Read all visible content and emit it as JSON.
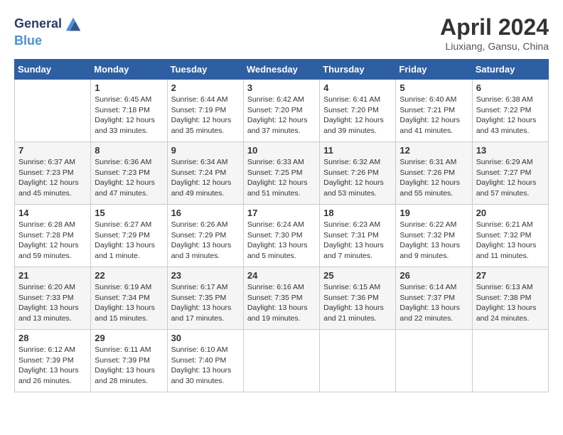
{
  "header": {
    "logo_line1": "General",
    "logo_line2": "Blue",
    "month": "April 2024",
    "location": "Liuxiang, Gansu, China"
  },
  "days_of_week": [
    "Sunday",
    "Monday",
    "Tuesday",
    "Wednesday",
    "Thursday",
    "Friday",
    "Saturday"
  ],
  "weeks": [
    [
      {
        "day": "",
        "sunrise": "",
        "sunset": "",
        "daylight": ""
      },
      {
        "day": "1",
        "sunrise": "Sunrise: 6:45 AM",
        "sunset": "Sunset: 7:18 PM",
        "daylight": "Daylight: 12 hours and 33 minutes."
      },
      {
        "day": "2",
        "sunrise": "Sunrise: 6:44 AM",
        "sunset": "Sunset: 7:19 PM",
        "daylight": "Daylight: 12 hours and 35 minutes."
      },
      {
        "day": "3",
        "sunrise": "Sunrise: 6:42 AM",
        "sunset": "Sunset: 7:20 PM",
        "daylight": "Daylight: 12 hours and 37 minutes."
      },
      {
        "day": "4",
        "sunrise": "Sunrise: 6:41 AM",
        "sunset": "Sunset: 7:20 PM",
        "daylight": "Daylight: 12 hours and 39 minutes."
      },
      {
        "day": "5",
        "sunrise": "Sunrise: 6:40 AM",
        "sunset": "Sunset: 7:21 PM",
        "daylight": "Daylight: 12 hours and 41 minutes."
      },
      {
        "day": "6",
        "sunrise": "Sunrise: 6:38 AM",
        "sunset": "Sunset: 7:22 PM",
        "daylight": "Daylight: 12 hours and 43 minutes."
      }
    ],
    [
      {
        "day": "7",
        "sunrise": "Sunrise: 6:37 AM",
        "sunset": "Sunset: 7:23 PM",
        "daylight": "Daylight: 12 hours and 45 minutes."
      },
      {
        "day": "8",
        "sunrise": "Sunrise: 6:36 AM",
        "sunset": "Sunset: 7:23 PM",
        "daylight": "Daylight: 12 hours and 47 minutes."
      },
      {
        "day": "9",
        "sunrise": "Sunrise: 6:34 AM",
        "sunset": "Sunset: 7:24 PM",
        "daylight": "Daylight: 12 hours and 49 minutes."
      },
      {
        "day": "10",
        "sunrise": "Sunrise: 6:33 AM",
        "sunset": "Sunset: 7:25 PM",
        "daylight": "Daylight: 12 hours and 51 minutes."
      },
      {
        "day": "11",
        "sunrise": "Sunrise: 6:32 AM",
        "sunset": "Sunset: 7:26 PM",
        "daylight": "Daylight: 12 hours and 53 minutes."
      },
      {
        "day": "12",
        "sunrise": "Sunrise: 6:31 AM",
        "sunset": "Sunset: 7:26 PM",
        "daylight": "Daylight: 12 hours and 55 minutes."
      },
      {
        "day": "13",
        "sunrise": "Sunrise: 6:29 AM",
        "sunset": "Sunset: 7:27 PM",
        "daylight": "Daylight: 12 hours and 57 minutes."
      }
    ],
    [
      {
        "day": "14",
        "sunrise": "Sunrise: 6:28 AM",
        "sunset": "Sunset: 7:28 PM",
        "daylight": "Daylight: 12 hours and 59 minutes."
      },
      {
        "day": "15",
        "sunrise": "Sunrise: 6:27 AM",
        "sunset": "Sunset: 7:29 PM",
        "daylight": "Daylight: 13 hours and 1 minute."
      },
      {
        "day": "16",
        "sunrise": "Sunrise: 6:26 AM",
        "sunset": "Sunset: 7:29 PM",
        "daylight": "Daylight: 13 hours and 3 minutes."
      },
      {
        "day": "17",
        "sunrise": "Sunrise: 6:24 AM",
        "sunset": "Sunset: 7:30 PM",
        "daylight": "Daylight: 13 hours and 5 minutes."
      },
      {
        "day": "18",
        "sunrise": "Sunrise: 6:23 AM",
        "sunset": "Sunset: 7:31 PM",
        "daylight": "Daylight: 13 hours and 7 minutes."
      },
      {
        "day": "19",
        "sunrise": "Sunrise: 6:22 AM",
        "sunset": "Sunset: 7:32 PM",
        "daylight": "Daylight: 13 hours and 9 minutes."
      },
      {
        "day": "20",
        "sunrise": "Sunrise: 6:21 AM",
        "sunset": "Sunset: 7:32 PM",
        "daylight": "Daylight: 13 hours and 11 minutes."
      }
    ],
    [
      {
        "day": "21",
        "sunrise": "Sunrise: 6:20 AM",
        "sunset": "Sunset: 7:33 PM",
        "daylight": "Daylight: 13 hours and 13 minutes."
      },
      {
        "day": "22",
        "sunrise": "Sunrise: 6:19 AM",
        "sunset": "Sunset: 7:34 PM",
        "daylight": "Daylight: 13 hours and 15 minutes."
      },
      {
        "day": "23",
        "sunrise": "Sunrise: 6:17 AM",
        "sunset": "Sunset: 7:35 PM",
        "daylight": "Daylight: 13 hours and 17 minutes."
      },
      {
        "day": "24",
        "sunrise": "Sunrise: 6:16 AM",
        "sunset": "Sunset: 7:35 PM",
        "daylight": "Daylight: 13 hours and 19 minutes."
      },
      {
        "day": "25",
        "sunrise": "Sunrise: 6:15 AM",
        "sunset": "Sunset: 7:36 PM",
        "daylight": "Daylight: 13 hours and 21 minutes."
      },
      {
        "day": "26",
        "sunrise": "Sunrise: 6:14 AM",
        "sunset": "Sunset: 7:37 PM",
        "daylight": "Daylight: 13 hours and 22 minutes."
      },
      {
        "day": "27",
        "sunrise": "Sunrise: 6:13 AM",
        "sunset": "Sunset: 7:38 PM",
        "daylight": "Daylight: 13 hours and 24 minutes."
      }
    ],
    [
      {
        "day": "28",
        "sunrise": "Sunrise: 6:12 AM",
        "sunset": "Sunset: 7:39 PM",
        "daylight": "Daylight: 13 hours and 26 minutes."
      },
      {
        "day": "29",
        "sunrise": "Sunrise: 6:11 AM",
        "sunset": "Sunset: 7:39 PM",
        "daylight": "Daylight: 13 hours and 28 minutes."
      },
      {
        "day": "30",
        "sunrise": "Sunrise: 6:10 AM",
        "sunset": "Sunset: 7:40 PM",
        "daylight": "Daylight: 13 hours and 30 minutes."
      },
      {
        "day": "",
        "sunrise": "",
        "sunset": "",
        "daylight": ""
      },
      {
        "day": "",
        "sunrise": "",
        "sunset": "",
        "daylight": ""
      },
      {
        "day": "",
        "sunrise": "",
        "sunset": "",
        "daylight": ""
      },
      {
        "day": "",
        "sunrise": "",
        "sunset": "",
        "daylight": ""
      }
    ]
  ]
}
